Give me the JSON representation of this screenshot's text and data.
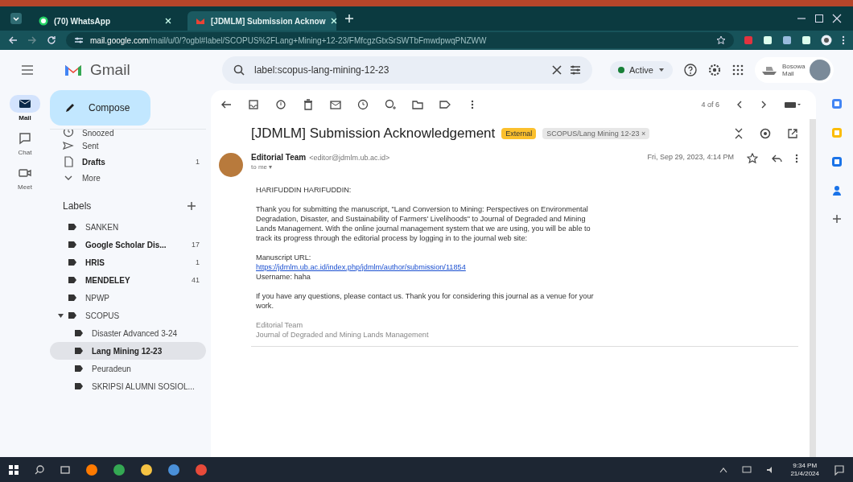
{
  "browser": {
    "tabs": [
      {
        "title": "(70) WhatsApp",
        "kind": "whatsapp",
        "selected": false
      },
      {
        "title": "[JDMLM] Submission Acknow",
        "kind": "gmail",
        "selected": true
      }
    ],
    "url": {
      "host": "mail.google.com",
      "path": "/mail/u/0/?ogbl#label/SCOPUS%2FLang+Mining+12-23/FMfcgzGtxSrSWTbFmwdpwqPNZWW"
    }
  },
  "gmail": {
    "product": "Gmail",
    "search": {
      "value": "label:scopus-lang-mining-12-23"
    },
    "status": "Active",
    "account": {
      "line1": "Bosowa",
      "line2": "Mail"
    }
  },
  "rail": [
    {
      "label": "Mail",
      "selected": true
    },
    {
      "label": "Chat",
      "selected": false
    },
    {
      "label": "Meet",
      "selected": false
    }
  ],
  "sidebar": {
    "compose": "Compose",
    "items": [
      {
        "label": "Snoozed",
        "kind": "clock",
        "bold": false
      },
      {
        "label": "Sent",
        "kind": "sent",
        "bold": false
      },
      {
        "label": "Drafts",
        "kind": "draft",
        "count": "1",
        "bold": true
      },
      {
        "label": "More",
        "kind": "more",
        "bold": false
      }
    ],
    "labels_title": "Labels",
    "labels": [
      {
        "label": "SANKEN",
        "bold": false,
        "selected": false
      },
      {
        "label": "Google Scholar Dis...",
        "count": "17",
        "bold": true,
        "selected": false
      },
      {
        "label": "HRIS",
        "count": "1",
        "bold": true,
        "selected": false
      },
      {
        "label": "MENDELEY",
        "count": "41",
        "bold": true,
        "selected": false
      },
      {
        "label": "NPWP",
        "bold": false,
        "selected": false
      },
      {
        "label": "SCOPUS",
        "bold": false,
        "selected": false,
        "expanded": true,
        "children": [
          {
            "label": "Disaster Advanced 3-24",
            "bold": false,
            "selected": false
          },
          {
            "label": "Lang Mining 12-23",
            "bold": true,
            "selected": true
          },
          {
            "label": "Peuradeun",
            "bold": false,
            "selected": false
          },
          {
            "label": "SKRIPSI ALUMNI SOSIOL...",
            "bold": false,
            "selected": false
          }
        ]
      }
    ]
  },
  "message": {
    "pager": "4 of 6",
    "subject": "[JDMLM] Submission Acknowledgement",
    "tags": [
      {
        "label": "External",
        "kind": "external"
      },
      {
        "label": "SCOPUS/Lang Mining 12-23 ×",
        "kind": "label"
      }
    ],
    "sender": "Editorial Team",
    "email": "<editor@jdmlm.ub.ac.id>",
    "to": "to me ▾",
    "date": "Fri, Sep 29, 2023, 4:14 PM",
    "body": [
      {
        "kind": "text",
        "lines": [
          "HARIFUDDIN HARIFUDDIN:"
        ]
      },
      {
        "kind": "text",
        "lines": [
          "Thank you for submitting the manuscript, \"Land Conversion to Mining: Perspectives on Environmental Degradation, Disaster, and Sustainability of Farmers' Livelihoods\" to Journal of Degraded and Mining Lands Management. With the online journal management system that we are using, you will be able to track its progress through the editorial process by logging in to the journal web site:"
        ]
      },
      {
        "kind": "text",
        "lines": [
          "Manuscript URL:"
        ],
        "link": "https://jdmlm.ub.ac.id/index.php/jdmlm/author/submission/11854",
        "after": "Username: haha"
      },
      {
        "kind": "text",
        "lines": [
          "If you have any questions, please contact us. Thank you for considering this journal as a venue for your work."
        ]
      },
      {
        "kind": "signature",
        "lines": [
          "Editorial Team",
          "Journal of Degraded and Mining Lands Management"
        ]
      }
    ]
  },
  "taskbar": {
    "time": "9:34 PM",
    "date": "21/4/2024"
  }
}
